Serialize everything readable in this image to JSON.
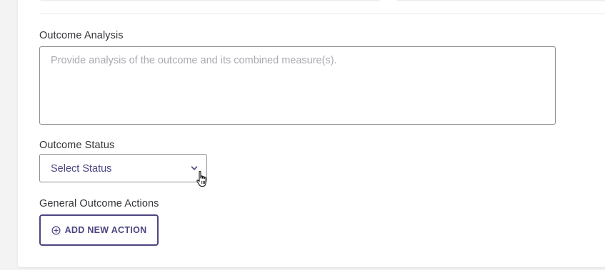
{
  "form": {
    "outcome_analysis": {
      "label": "Outcome Analysis",
      "placeholder": "Provide analysis of the outcome and its combined measure(s).",
      "value": ""
    },
    "outcome_status": {
      "label": "Outcome Status",
      "selected": "Select Status"
    },
    "general_actions": {
      "label": "General Outcome Actions",
      "add_button_label": "ADD NEW ACTION"
    }
  },
  "icons": {
    "dropdown": "chevron-down-icon",
    "add": "plus-circle-icon",
    "cursor": "hand-pointer-icon"
  },
  "colors": {
    "accent": "#4b4580",
    "select_text": "#4a4682",
    "placeholder": "#a9a9b2",
    "border": "#8c8c94",
    "background": "#f3f3f4"
  }
}
